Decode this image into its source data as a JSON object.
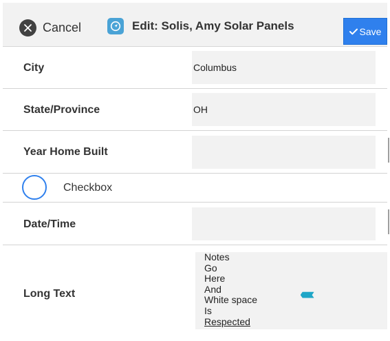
{
  "header": {
    "cancel_label": "Cancel",
    "title": "Edit: Solis, Amy Solar Panels",
    "save_label": "Save"
  },
  "fields": {
    "city": {
      "label": "City",
      "value": "Columbus"
    },
    "state": {
      "label": "State/Province",
      "value": "OH"
    },
    "year_built": {
      "label": "Year Home Built",
      "value": ""
    },
    "checkbox": {
      "label": "Checkbox",
      "checked": false
    },
    "date_time": {
      "label": "Date/Time",
      "value": ""
    },
    "long_text": {
      "label": "Long Text",
      "lines": [
        "Notes",
        "Go",
        "Here",
        "And",
        "White space",
        "Is",
        "Respected"
      ]
    }
  },
  "decoration": {
    "chevrons": "‹‹‹‹‹‹‹"
  },
  "colors": {
    "accent": "#2f80ed",
    "chevron": "#1fa6c7",
    "field_bg": "#f2f2f2"
  },
  "icons": [
    "close-icon",
    "app-navigation-icon",
    "checkmark-icon",
    "double-chevron-left-icon"
  ]
}
